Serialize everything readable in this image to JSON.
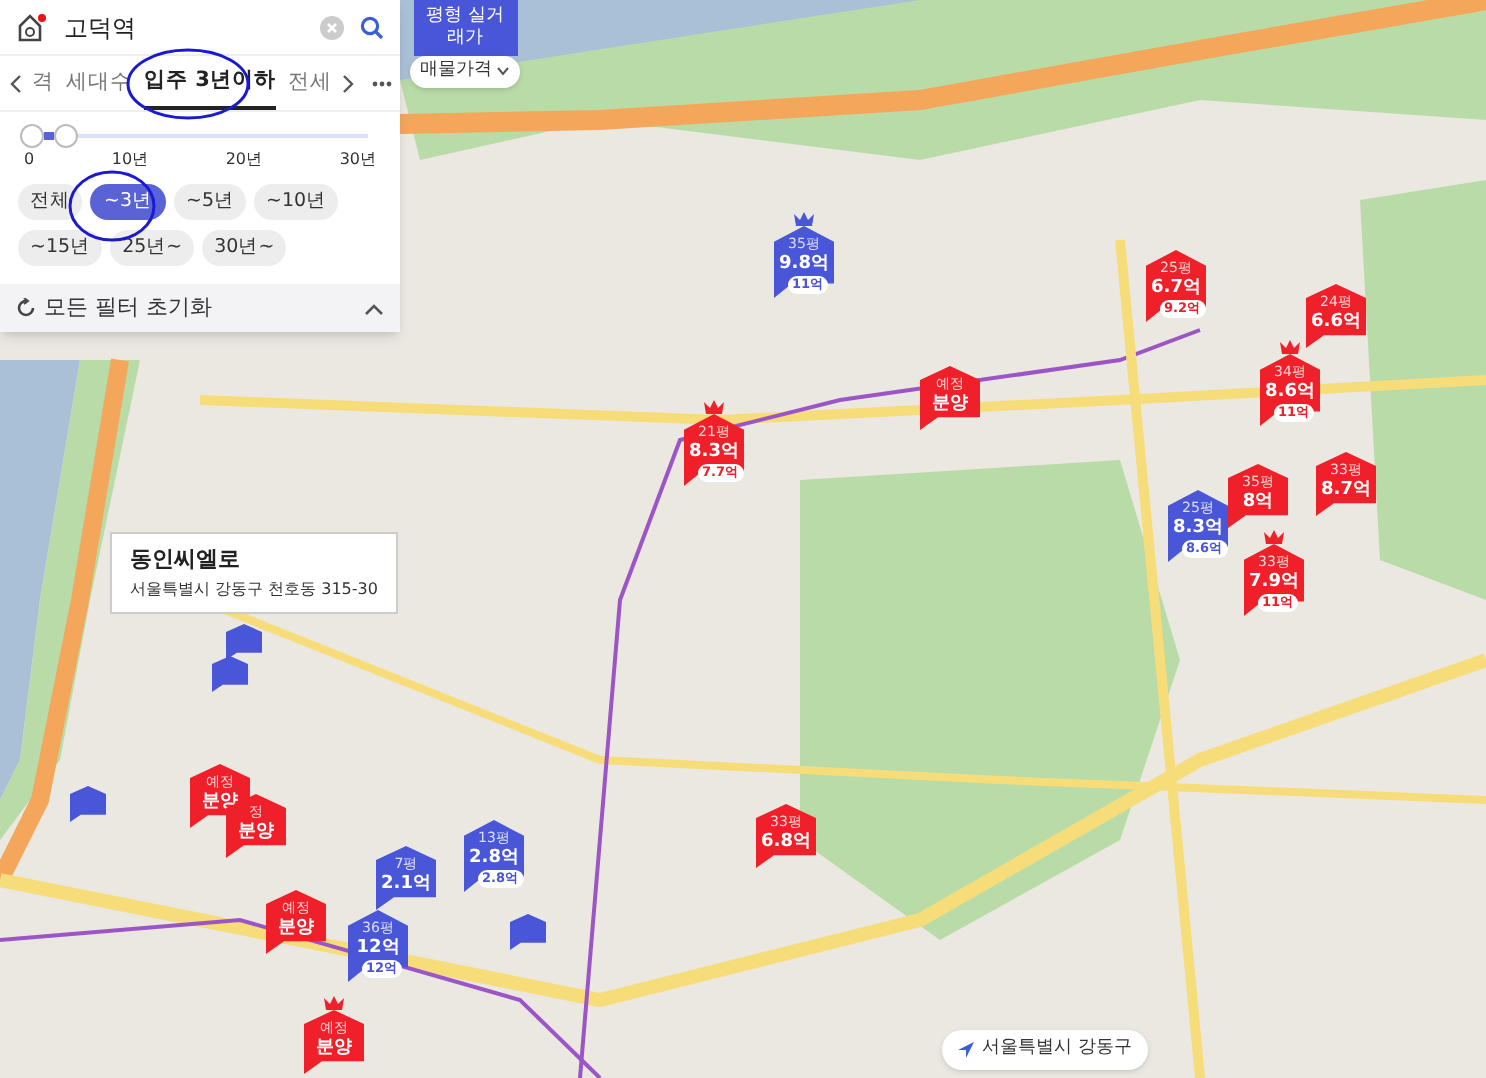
{
  "search": {
    "value": "고덕역"
  },
  "filter_tabs": [
    {
      "label": "격",
      "selected": false
    },
    {
      "label": "세대수",
      "selected": false
    },
    {
      "label": "입주 3년이하",
      "selected": true
    },
    {
      "label": "전세",
      "selected": false
    }
  ],
  "slider": {
    "level": 0.1,
    "ticks": [
      "0",
      "10년",
      "20년",
      "30년"
    ]
  },
  "chips": [
    {
      "label": "전체",
      "selected": false
    },
    {
      "label": "~3년",
      "selected": true
    },
    {
      "label": "~5년",
      "selected": false
    },
    {
      "label": "~10년",
      "selected": false
    },
    {
      "label": "~15년",
      "selected": false
    },
    {
      "label": "25년~",
      "selected": false
    },
    {
      "label": "30년~",
      "selected": false
    }
  ],
  "reset_label": "모든 필터 초기화",
  "price_toggle": {
    "label": "평형 실거래가",
    "dropdown": "매물가격"
  },
  "markers": [
    {
      "kind": "price",
      "color": "#4a56d8",
      "size": "35평",
      "price": "9.8억",
      "sub": "11억",
      "crown": true
    },
    {
      "kind": "price",
      "color": "#f0202a",
      "size": "25평",
      "price": "6.7억",
      "sub": "9.2억",
      "crown": false
    },
    {
      "kind": "price",
      "color": "#f0202a",
      "size": "24평",
      "price": "6.6억",
      "crown": false
    },
    {
      "kind": "presale",
      "color": "#f0202a",
      "size": "예정",
      "price": "분양",
      "crown": false
    },
    {
      "kind": "price",
      "color": "#f0202a",
      "size": "34평",
      "price": "8.6억",
      "sub": "11억",
      "crown": true
    },
    {
      "kind": "price",
      "color": "#f0202a",
      "size": "21평",
      "price": "8.3억",
      "sub": "7.7억",
      "crown": true
    },
    {
      "kind": "price",
      "color": "#4a56d8",
      "size": "25평",
      "price": "8.3억",
      "sub": "8.6억",
      "crown": false
    },
    {
      "kind": "price",
      "color": "#f0202a",
      "size": "35평",
      "price": "8억",
      "crown": false
    },
    {
      "kind": "price",
      "color": "#f0202a",
      "size": "33평",
      "price": "8.7억",
      "crown": false
    },
    {
      "kind": "price",
      "color": "#f0202a",
      "size": "33평",
      "price": "7.9억",
      "sub": "11억",
      "crown": true
    },
    {
      "kind": "blank",
      "color": "#4a56d8"
    },
    {
      "kind": "blank",
      "color": "#4a56d8"
    },
    {
      "kind": "blank",
      "color": "#4a56d8"
    },
    {
      "kind": "presale",
      "color": "#f0202a",
      "size": "예정",
      "price": "분양",
      "crown": false
    },
    {
      "kind": "presale",
      "color": "#f0202a",
      "size": "정",
      "price": "분양",
      "crown": false
    },
    {
      "kind": "price",
      "color": "#f0202a",
      "size": "33평",
      "price": "6.8억",
      "crown": false
    },
    {
      "kind": "price",
      "color": "#4a56d8",
      "size": "7평",
      "price": "2.1억",
      "crown": false
    },
    {
      "kind": "price",
      "color": "#4a56d8",
      "size": "13평",
      "price": "2.8억",
      "sub": "2.8억",
      "crown": false
    },
    {
      "kind": "presale",
      "color": "#f0202a",
      "size": "예정",
      "price": "분양",
      "crown": false
    },
    {
      "kind": "price",
      "color": "#4a56d8",
      "size": "36평",
      "price": "12억",
      "sub": "12억",
      "crown": false
    },
    {
      "kind": "blank",
      "color": "#4a56d8"
    },
    {
      "kind": "presale",
      "color": "#f0202a",
      "size": "예정",
      "price": "분양",
      "crown": true
    }
  ],
  "place_popup": {
    "name": "동인씨엘로",
    "address": "서울특별시 강동구 천호동 315-30"
  },
  "location": "서울특별시 강동구"
}
